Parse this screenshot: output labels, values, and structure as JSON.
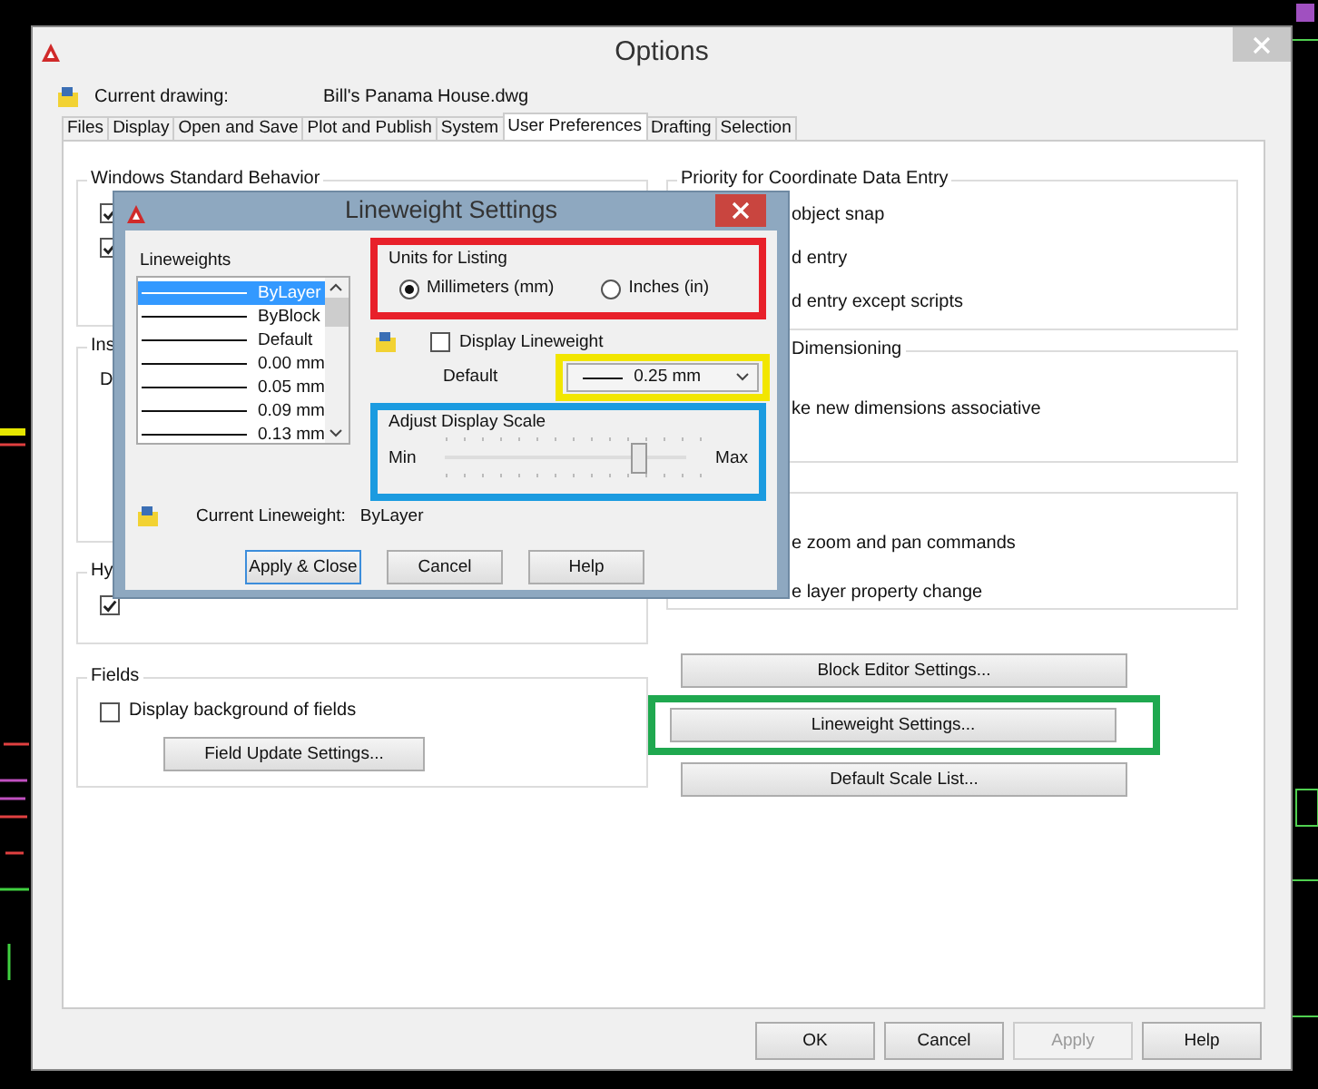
{
  "window": {
    "title": "Options"
  },
  "current_drawing": {
    "label": "Current drawing:",
    "value": "Bill's Panama House.dwg"
  },
  "tabs": [
    {
      "label": "Files",
      "selected": false
    },
    {
      "label": "Display",
      "selected": false
    },
    {
      "label": "Open and Save",
      "selected": false
    },
    {
      "label": "Plot and Publish",
      "selected": false
    },
    {
      "label": "System",
      "selected": false
    },
    {
      "label": "User Preferences",
      "selected": true
    },
    {
      "label": "Drafting",
      "selected": false
    },
    {
      "label": "Selection",
      "selected": false
    }
  ],
  "left_groups": [
    {
      "title": "Windows Standard Behavior",
      "items": [
        {
          "kind": "checkbox",
          "checked": true
        },
        {
          "kind": "checkbox",
          "checked": true
        }
      ]
    },
    {
      "title": "Ins",
      "items": [
        {
          "kind": "text",
          "label": "D"
        }
      ]
    },
    {
      "title": "Hy",
      "items": [
        {
          "kind": "checkbox",
          "checked": true
        }
      ]
    },
    {
      "title": "Fields",
      "items": [
        {
          "kind": "checkbox",
          "checked": false,
          "label": "Display background of fields"
        },
        {
          "kind": "button",
          "label": "Field Update Settings..."
        }
      ]
    }
  ],
  "right_groups": [
    {
      "title": "Priority for Coordinate Data Entry",
      "items": [
        {
          "label": "object snap"
        },
        {
          "label": "d entry"
        },
        {
          "label": "d entry except scripts"
        }
      ]
    },
    {
      "title": "Dimensioning",
      "items": [
        {
          "label": "ke new dimensions associative"
        }
      ]
    },
    {
      "items": [
        {
          "label": "e zoom and pan commands"
        },
        {
          "label": "e layer property change"
        }
      ]
    }
  ],
  "right_buttons": [
    {
      "label": "Block Editor Settings..."
    },
    {
      "label": "Lineweight Settings...",
      "kind": "framed"
    },
    {
      "label": "Default Scale List..."
    }
  ],
  "footer_buttons": [
    {
      "label": "OK",
      "disabled": false
    },
    {
      "label": "Cancel",
      "disabled": false
    },
    {
      "label": "Apply",
      "disabled": true
    },
    {
      "label": "Help",
      "disabled": false
    }
  ],
  "lineweight_dialog": {
    "title": "Lineweight Settings",
    "lineweights": {
      "title": "Lineweights",
      "items": [
        {
          "label": "ByLayer",
          "selected": true
        },
        {
          "label": "ByBlock",
          "selected": false
        },
        {
          "label": "Default",
          "selected": false
        },
        {
          "label": "0.00 mm",
          "selected": false
        },
        {
          "label": "0.05 mm",
          "selected": false
        },
        {
          "label": "0.09 mm",
          "selected": false
        },
        {
          "label": "0.13 mm",
          "selected": false
        }
      ]
    },
    "units": {
      "title": "Units for Listing",
      "options": [
        {
          "label": "Millimeters (mm)",
          "selected": true
        },
        {
          "label": "Inches (in)",
          "selected": false
        }
      ]
    },
    "display_lineweight": {
      "label": "Display Lineweight",
      "checked": false
    },
    "default": {
      "label": "Default",
      "value": "0.25 mm"
    },
    "scale": {
      "title": "Adjust Display Scale",
      "min_label": "Min",
      "max_label": "Max",
      "level": 0.8
    },
    "current": {
      "label": "Current Lineweight:",
      "value": "ByLayer"
    },
    "buttons": [
      {
        "label": "Apply & Close",
        "focused": true
      },
      {
        "label": "Cancel",
        "focused": false
      },
      {
        "label": "Help",
        "focused": false
      }
    ]
  },
  "annotation_frames": [
    {
      "kind": "units",
      "color": "#e8202a"
    },
    {
      "kind": "default",
      "color": "#f2e600"
    },
    {
      "kind": "scale",
      "color": "#1b9be0"
    },
    {
      "kind": "lineweight_button",
      "color": "#1fa84f"
    }
  ]
}
